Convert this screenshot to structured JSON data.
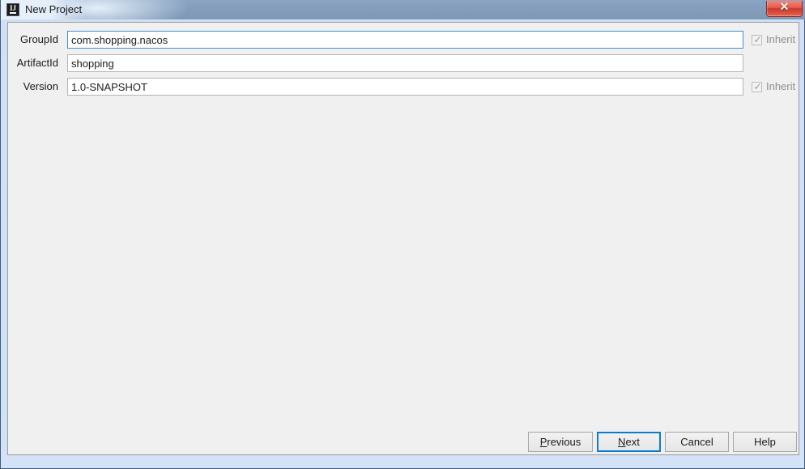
{
  "window": {
    "title": "New Project",
    "app_icon": "intellij-idea-icon",
    "app_icon_text": "IJ",
    "close_button": {
      "icon": "close-icon",
      "glyph": "✕",
      "color": "#c9392c"
    },
    "titlebar_color": "#829cba",
    "frame_color": "#cfe0f5",
    "background_color": "#f0f0f0"
  },
  "form": {
    "fields": [
      {
        "label": "GroupId",
        "value": "com.shopping.nacos",
        "placeholder": "",
        "focused": true,
        "name": "groupid",
        "inherit": {
          "label": "Inherit",
          "checked": true,
          "enabled": false,
          "glyph": "✓"
        }
      },
      {
        "label": "ArtifactId",
        "value": "shopping",
        "placeholder": "",
        "focused": false,
        "name": "artifactid",
        "inherit": null
      },
      {
        "label": "Version",
        "value": "1.0-SNAPSHOT",
        "placeholder": "",
        "focused": false,
        "name": "version",
        "inherit": {
          "label": "Inherit",
          "checked": true,
          "enabled": false,
          "glyph": "✓"
        }
      }
    ]
  },
  "buttons": {
    "previous": {
      "label": "Previous",
      "mnemonic": "P",
      "default": false
    },
    "next": {
      "label": "Next",
      "mnemonic": "N",
      "default": true,
      "focus_color": "#0a7bd1"
    },
    "cancel": {
      "label": "Cancel",
      "mnemonic": "",
      "default": false
    },
    "help": {
      "label": "Help",
      "mnemonic": "",
      "default": false
    }
  }
}
